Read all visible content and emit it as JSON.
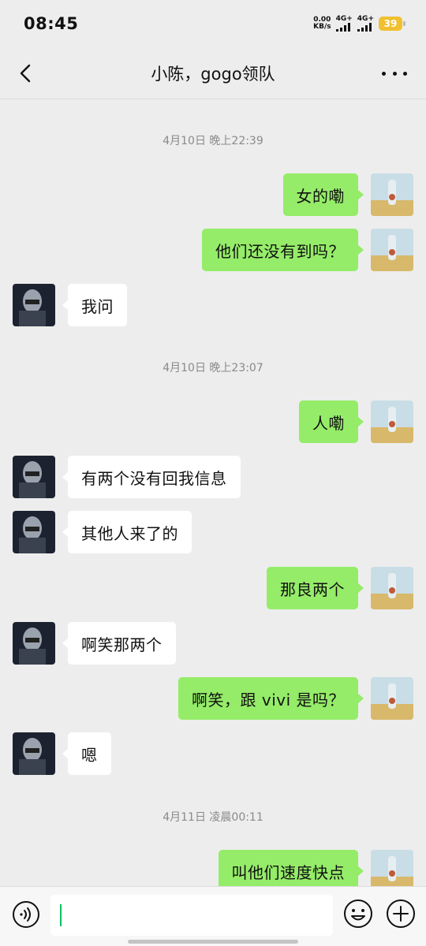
{
  "status_bar": {
    "time": "08:45",
    "net_speed_value": "0.00",
    "net_speed_unit": "KB/s",
    "signal_label_1": "4G+",
    "signal_label_2": "4G+",
    "battery": "39"
  },
  "header": {
    "title": "小陈，gogo领队",
    "back_icon": "chevron-left-icon",
    "more_icon": "more-dots-icon"
  },
  "chat": {
    "timestamps": [
      "4月10日 晚上22:39",
      "4月10日 晚上23:07",
      "4月11日 凌晨00:11"
    ],
    "messages": [
      {
        "sender": "me",
        "text": "女的嘞"
      },
      {
        "sender": "me",
        "text": "他们还没有到吗？"
      },
      {
        "sender": "other",
        "text": "我问"
      },
      {
        "sender": "me",
        "text": "人嘞"
      },
      {
        "sender": "other",
        "text": "有两个没有回我信息"
      },
      {
        "sender": "other",
        "text": "其他人来了的"
      },
      {
        "sender": "me",
        "text": "那良两个"
      },
      {
        "sender": "other",
        "text": "啊笑那两个"
      },
      {
        "sender": "me",
        "text": "啊笑，跟 vivi 是吗？"
      },
      {
        "sender": "other",
        "text": "嗯"
      },
      {
        "sender": "me",
        "text": "叫他们速度快点"
      }
    ]
  },
  "input_bar": {
    "voice_icon": "voice-icon",
    "emoji_icon": "emoji-icon",
    "plus_icon": "plus-circle-icon",
    "value": ""
  },
  "colors": {
    "background": "#ededed",
    "my_bubble": "#95ec69",
    "other_bubble": "#ffffff",
    "timestamp_text": "#8a8a8a",
    "caret": "#07c160"
  }
}
